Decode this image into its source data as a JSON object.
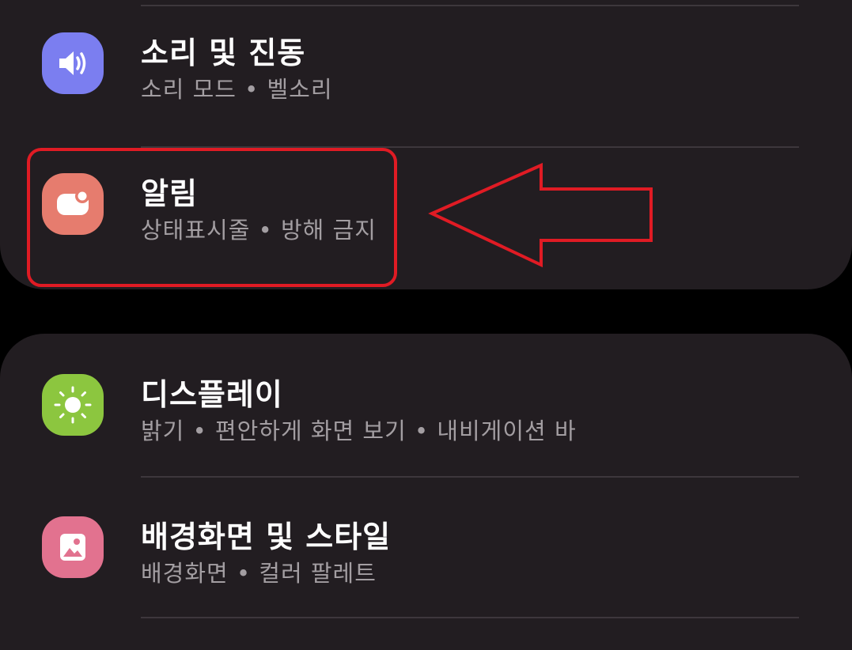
{
  "settings": {
    "items": [
      {
        "title": "소리 및 진동",
        "subtitle": "소리 모드 • 벨소리",
        "icon": "speaker-icon",
        "color": "#7b7ef0"
      },
      {
        "title": "알림",
        "subtitle": "상태표시줄 • 방해 금지",
        "icon": "notification-icon",
        "color": "#e67c6e"
      },
      {
        "title": "디스플레이",
        "subtitle": "밝기 • 편안하게 화면 보기 • 내비게이션 바",
        "icon": "sun-icon",
        "color": "#8cc63f"
      },
      {
        "title": "배경화면 및 스타일",
        "subtitle": "배경화면 • 컬러 팔레트",
        "icon": "wallpaper-icon",
        "color": "#e2728f"
      }
    ]
  },
  "annotation": {
    "highlight_color": "#e01b24",
    "highlight_target": "알림"
  }
}
